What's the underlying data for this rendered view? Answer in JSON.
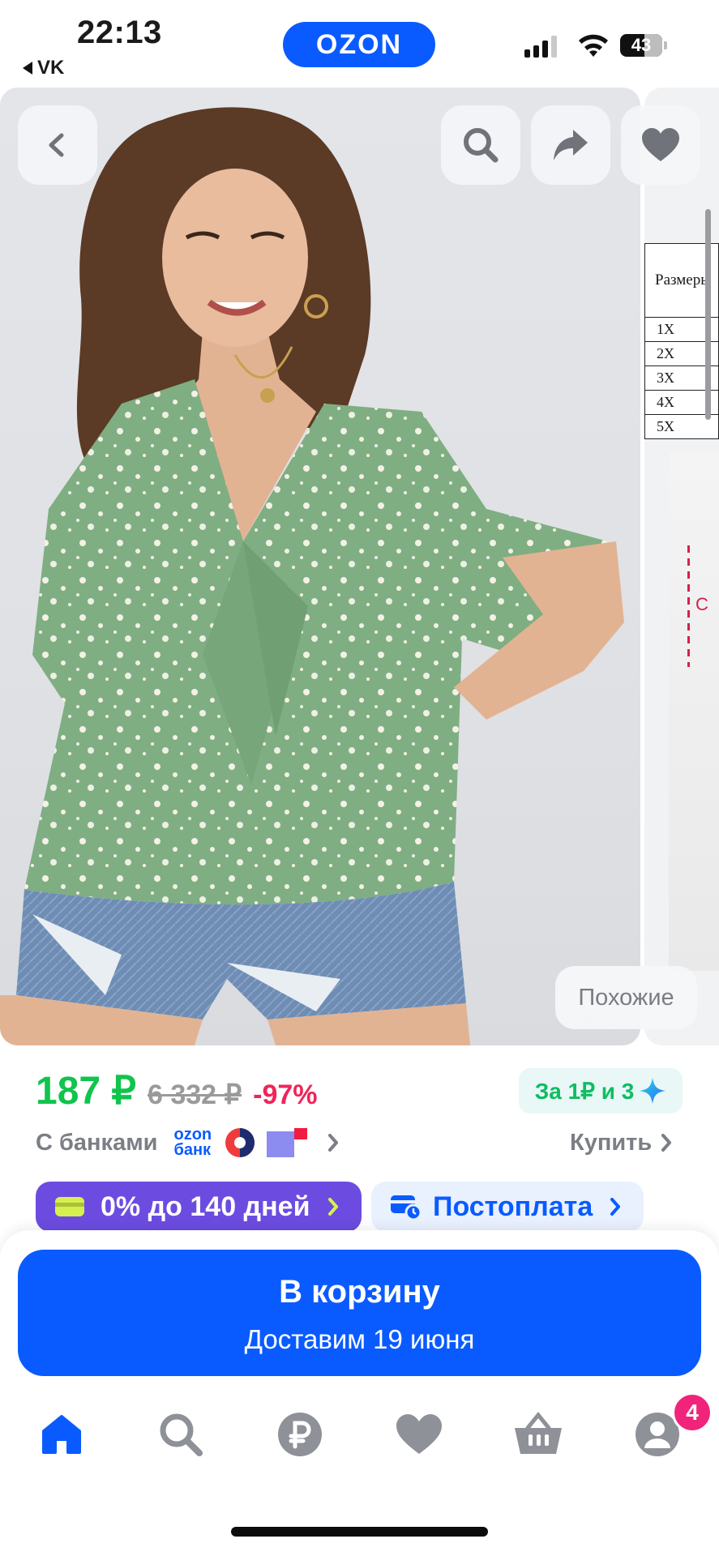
{
  "status_bar": {
    "time": "22:13",
    "back_app": "VK",
    "battery": "43",
    "brand_logo": "OZON"
  },
  "gallery": {
    "side_table": {
      "header": "Размеры",
      "rows": [
        "1X",
        "2X",
        "3X",
        "4X",
        "5X"
      ],
      "dim_label": "C"
    },
    "similar_button": "Похожие",
    "icons": [
      "back-arrow-icon",
      "search-icon",
      "share-icon",
      "heart-icon"
    ]
  },
  "price": {
    "current": "187 ₽",
    "old": "6 332 ₽",
    "discount": "-97%"
  },
  "bonus_chip": {
    "label": "За 1₽ и 3"
  },
  "banks": {
    "label": "С банками",
    "ozon_bank_line1": "ozon",
    "ozon_bank_line2": "банк",
    "buy_link": "Купить"
  },
  "pills": {
    "installment": "0% до 140 дней",
    "postpay": "Постоплата"
  },
  "cart": {
    "title": "В корзину",
    "subtitle": "Доставим 19 июня"
  },
  "tabbar": {
    "items": [
      "home-icon",
      "search-icon",
      "ruble-icon",
      "favorites-icon",
      "basket-icon",
      "profile-icon"
    ],
    "profile_badge": "4"
  },
  "colors": {
    "brand_blue": "#0a5bff",
    "price_green": "#10c44c",
    "discount_pink": "#f0245a",
    "installment_purple": "#6c4ce0",
    "badge_pink": "#f0247a"
  }
}
